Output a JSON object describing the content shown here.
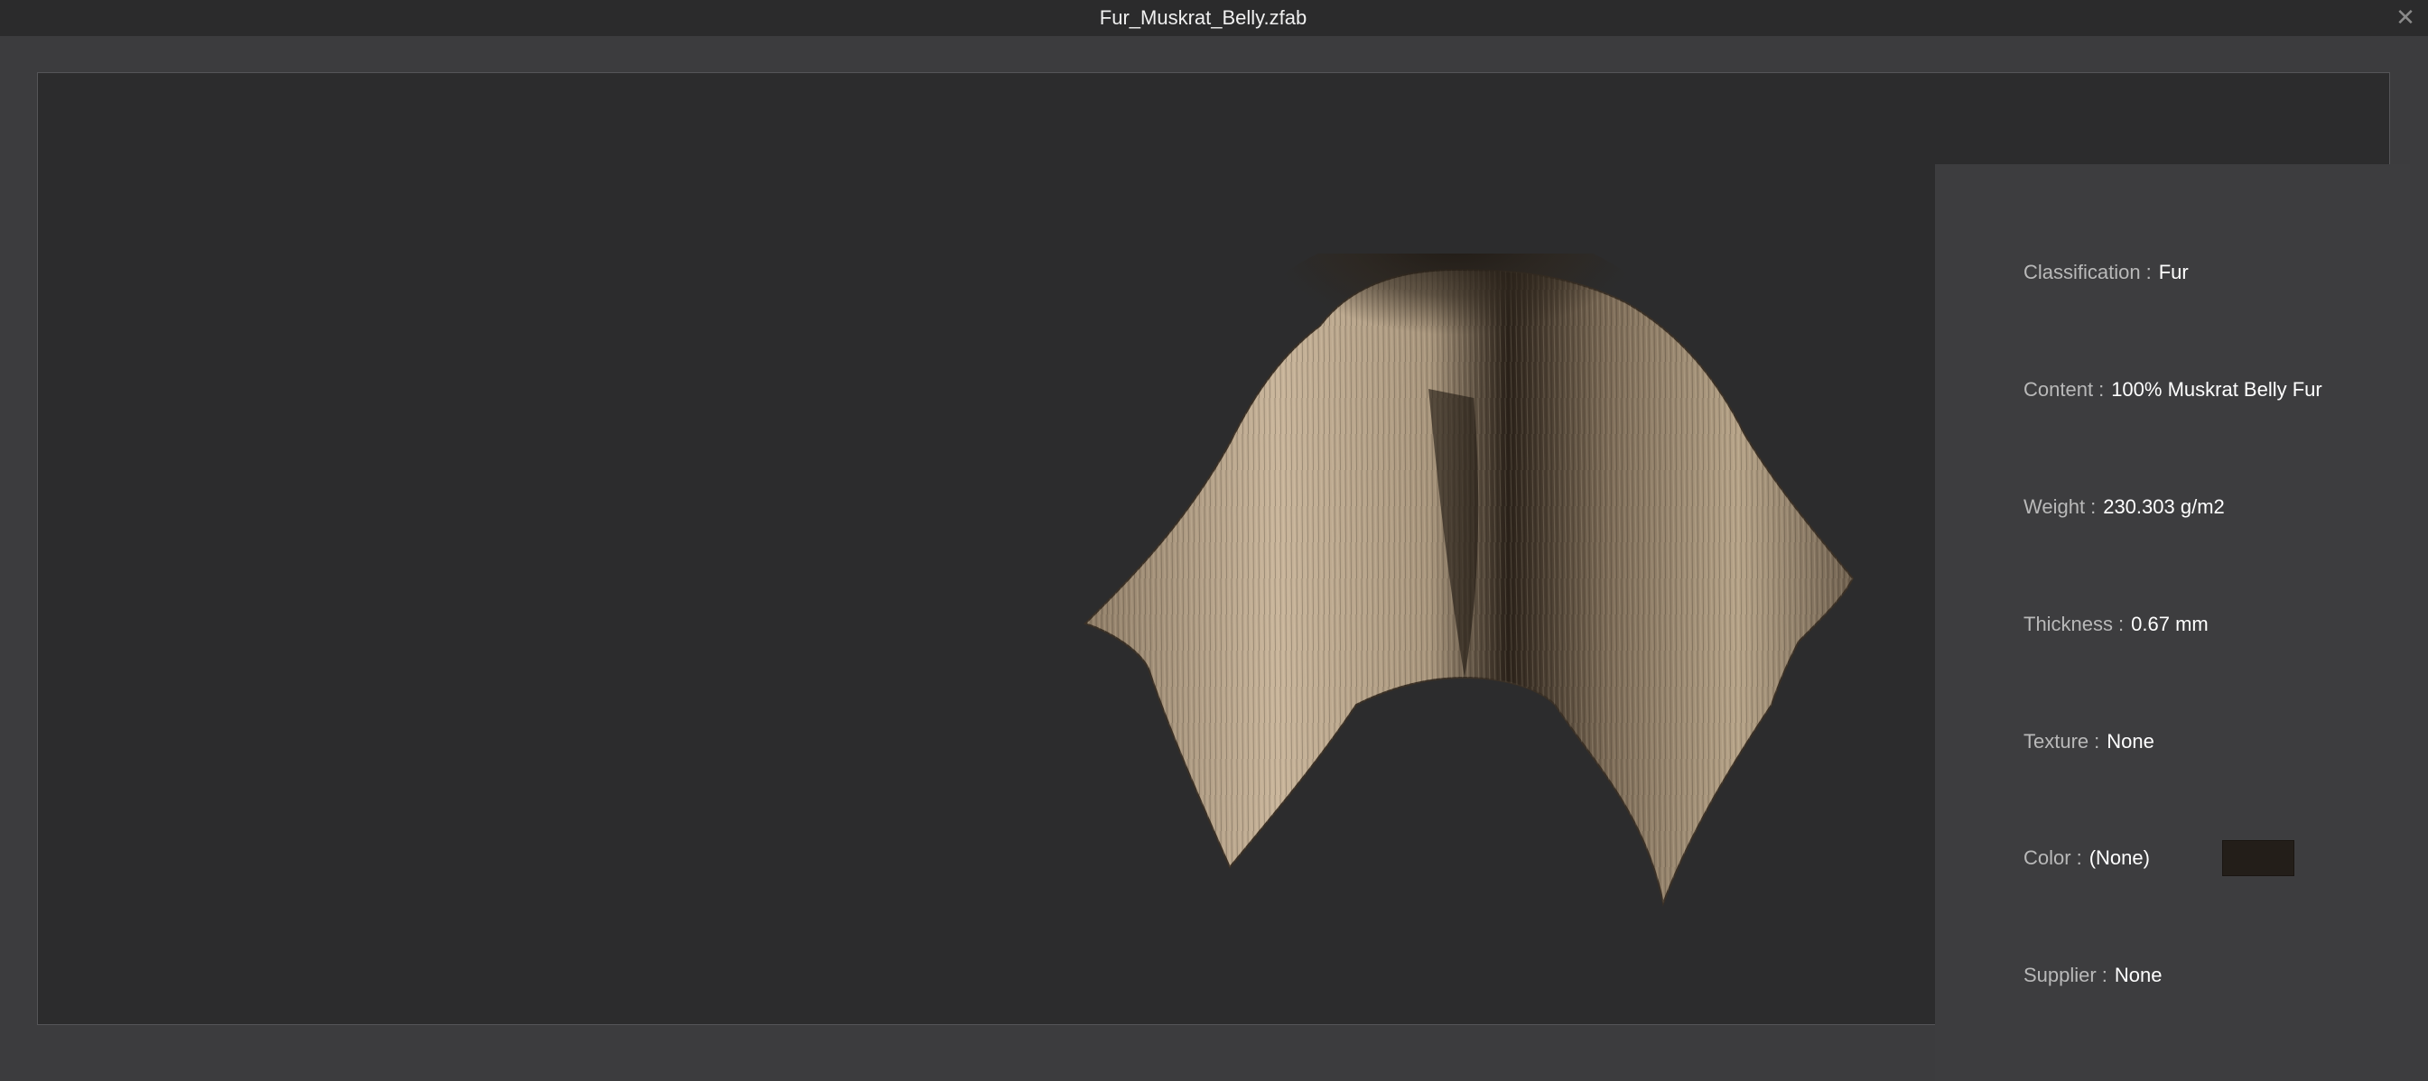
{
  "window": {
    "title": "Fur_Muskrat_Belly.zfab",
    "close_glyph": "✕"
  },
  "colors": {
    "fabric_swatch": "#231e19",
    "fur_light": "#c8b49a",
    "fur_dark": "#2a221a"
  },
  "info": {
    "separator": ":",
    "rows": [
      {
        "label": "Classification",
        "value": "Fur"
      },
      {
        "label": "Content",
        "value": "100% Muskrat Belly Fur"
      },
      {
        "label": "Weight",
        "value": "230.303 g/m2"
      },
      {
        "label": "Thickness",
        "value": "0.67 mm"
      },
      {
        "label": "Texture",
        "value": "None"
      },
      {
        "label": "Color",
        "value": "(None)"
      },
      {
        "label": "Supplier",
        "value": "None"
      }
    ]
  }
}
